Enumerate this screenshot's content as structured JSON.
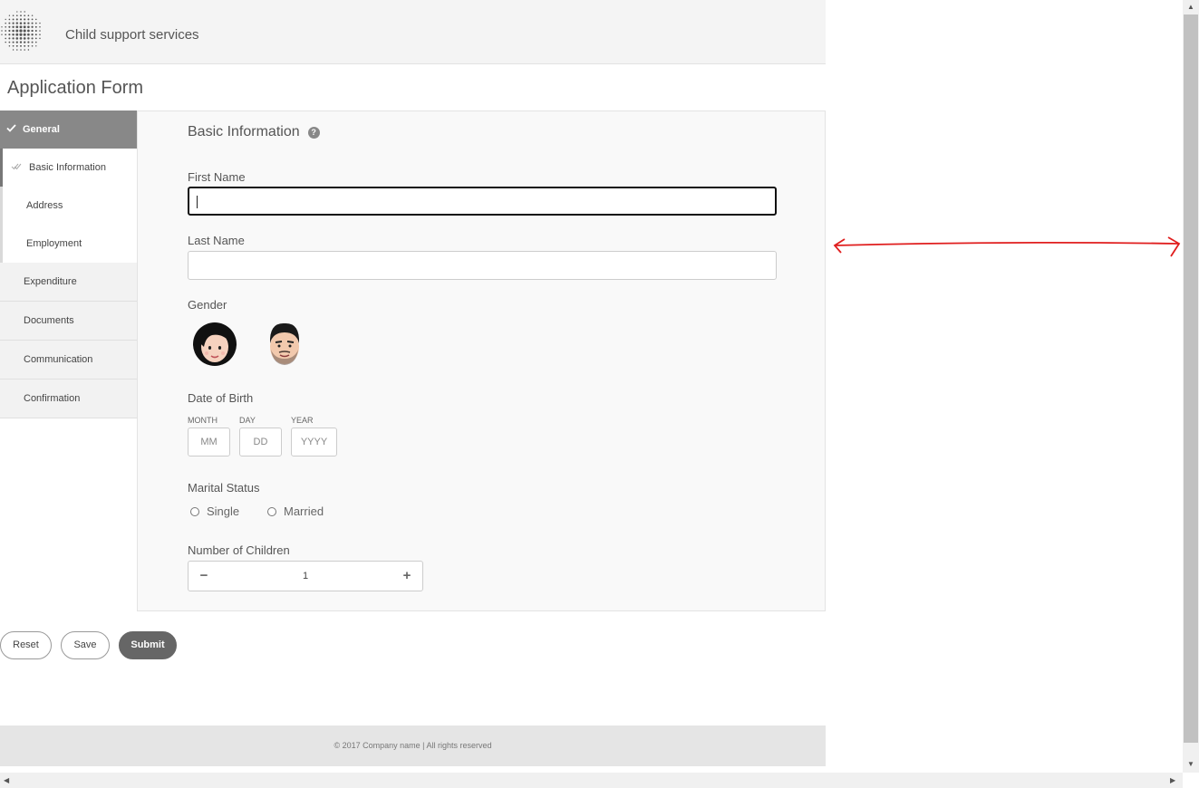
{
  "header": {
    "site_title": "Child support services",
    "logo_icon": "dotted-sphere-logo"
  },
  "page_title": "Application Form",
  "sidebar": {
    "general": {
      "label": "General",
      "icon": "check-icon"
    },
    "sub_items": [
      {
        "label": "Basic Information",
        "active": true
      },
      {
        "label": "Address"
      },
      {
        "label": "Employment"
      }
    ],
    "items": [
      {
        "label": "Expenditure"
      },
      {
        "label": "Documents"
      },
      {
        "label": "Communication"
      },
      {
        "label": "Confirmation"
      }
    ]
  },
  "form": {
    "section_title": "Basic Information",
    "help_glyph": "?",
    "first_name": {
      "label": "First Name",
      "value": ""
    },
    "last_name": {
      "label": "Last Name",
      "value": ""
    },
    "gender": {
      "label": "Gender",
      "options": [
        "female-avatar",
        "male-avatar"
      ]
    },
    "dob": {
      "label": "Date of Birth",
      "month": {
        "label": "MONTH",
        "placeholder": "MM"
      },
      "day": {
        "label": "DAY",
        "placeholder": "DD"
      },
      "year": {
        "label": "YEAR",
        "placeholder": "YYYY"
      }
    },
    "marital": {
      "label": "Marital Status",
      "options": [
        "Single",
        "Married"
      ]
    },
    "children": {
      "label": "Number of Children",
      "value": "1",
      "minus": "−",
      "plus": "+"
    }
  },
  "buttons": {
    "reset": "Reset",
    "save": "Save",
    "submit": "Submit"
  },
  "footer": {
    "text": "© 2017 Company name | All rights reserved"
  },
  "colors": {
    "annotation": "#e01e1e",
    "sidebar_active": "#888888",
    "submit_bg": "#666666"
  }
}
